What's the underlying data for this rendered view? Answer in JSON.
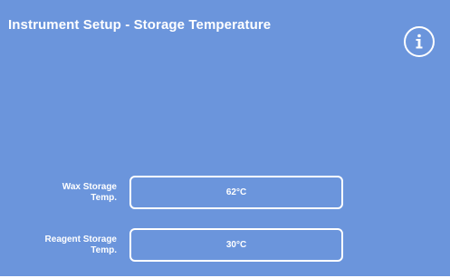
{
  "header": {
    "title": "Instrument Setup - Storage Temperature",
    "info_icon": "info-icon"
  },
  "settings": {
    "wax": {
      "label_line1": "Wax Storage",
      "label_line2": "Temp.",
      "value": "62°C"
    },
    "reagent": {
      "label_line1": "Reagent Storage",
      "label_line2": "Temp.",
      "value": "30°C"
    }
  },
  "colors": {
    "background": "#6b95dc",
    "foreground": "#ffffff"
  }
}
